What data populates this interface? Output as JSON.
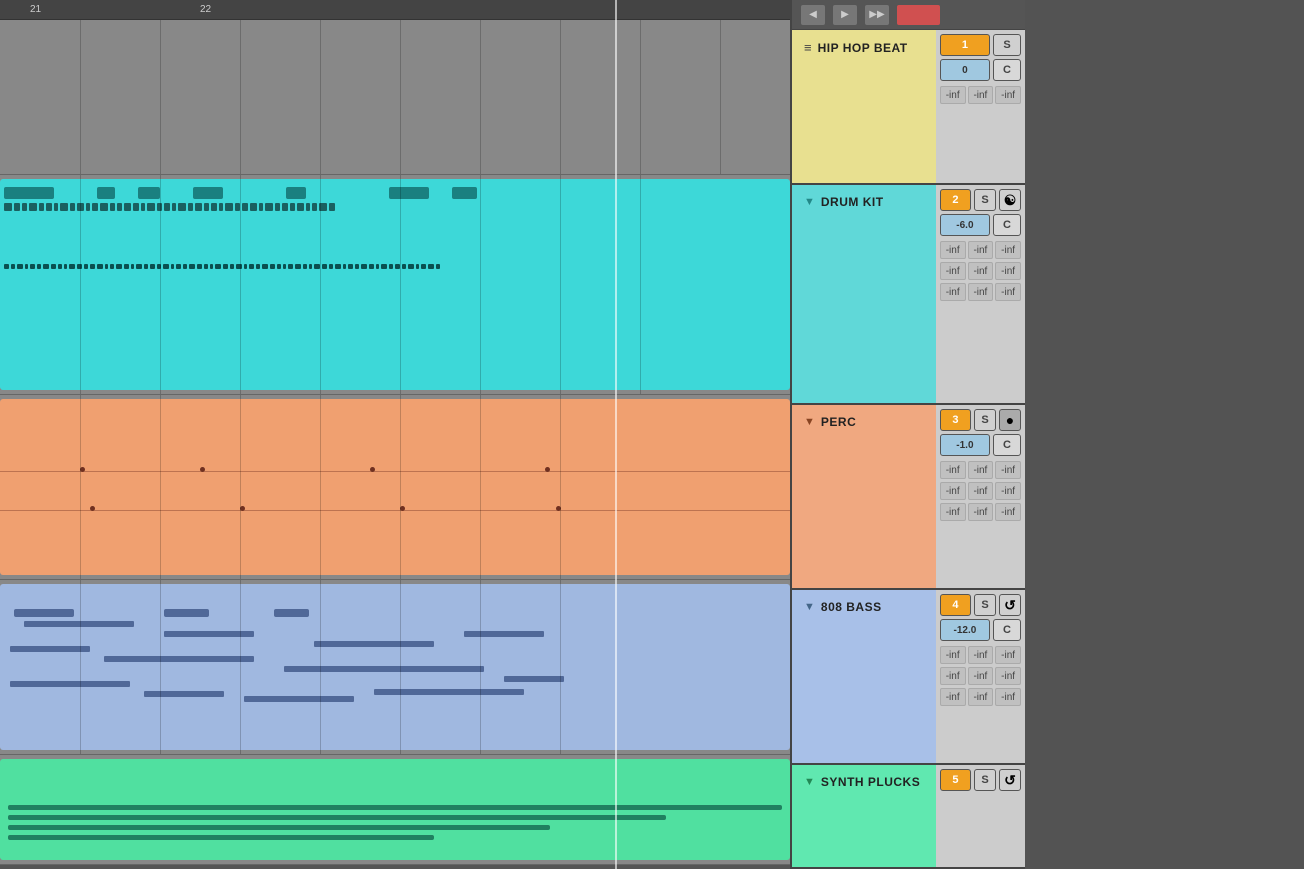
{
  "ruler": {
    "marks": [
      "21",
      "22"
    ]
  },
  "nav": {
    "btn1": "◀",
    "btn2": "▶",
    "btn3": "⏺"
  },
  "tracks": [
    {
      "id": "hip-hop-beat",
      "name": "HIP HOP BEAT",
      "icon": "≡",
      "number": "1",
      "volume": "0",
      "send1": "-inf",
      "send2": "-inf",
      "send3": "-inf",
      "hasS": true,
      "hasC": true,
      "colorClass": "hip-hop-bg",
      "sectionClass": "section-hip-hop",
      "labelClass": "track-label-area-hip-hop"
    },
    {
      "id": "drum-kit",
      "name": "DRUM KIT",
      "icon": "▼",
      "number": "2",
      "volume": "-6.0",
      "send1": "-inf",
      "send2": "-inf",
      "send3": "-inf",
      "send4": "-inf",
      "send5": "-inf",
      "send6": "-inf",
      "send7": "-inf",
      "send8": "-inf",
      "send9": "-inf",
      "hasS": true,
      "hasC": true,
      "colorClass": "drum-bg",
      "sectionClass": "section-drum",
      "labelClass": "track-label-area-drum"
    },
    {
      "id": "perc",
      "name": "PERC",
      "icon": "▼",
      "number": "3",
      "volume": "-1.0",
      "send1": "-inf",
      "send2": "-inf",
      "send3": "-inf",
      "send4": "-inf",
      "send5": "-inf",
      "send6": "-inf",
      "send7": "-inf",
      "send8": "-inf",
      "send9": "-inf",
      "hasS": true,
      "hasC": true,
      "colorClass": "perc-bg",
      "sectionClass": "section-perc",
      "labelClass": "track-label-area-perc"
    },
    {
      "id": "808-bass",
      "name": "808 BASS",
      "icon": "▼",
      "number": "4",
      "volume": "-12.0",
      "send1": "-inf",
      "send2": "-inf",
      "send3": "-inf",
      "send4": "-inf",
      "send5": "-inf",
      "send6": "-inf",
      "send7": "-inf",
      "send8": "-inf",
      "send9": "-inf",
      "hasS": true,
      "hasC": true,
      "colorClass": "bass-bg",
      "sectionClass": "section-bass",
      "labelClass": "track-label-area-bass"
    },
    {
      "id": "synth-plucks",
      "name": "SYNTH PLUCKS",
      "icon": "▼",
      "number": "5",
      "volume": "",
      "hasS": true,
      "hasC": false,
      "colorClass": "synth-bg",
      "sectionClass": "section-synth",
      "labelClass": "track-label-area-synth"
    }
  ],
  "infLabel": "-inf",
  "infPosLabel": "inf"
}
